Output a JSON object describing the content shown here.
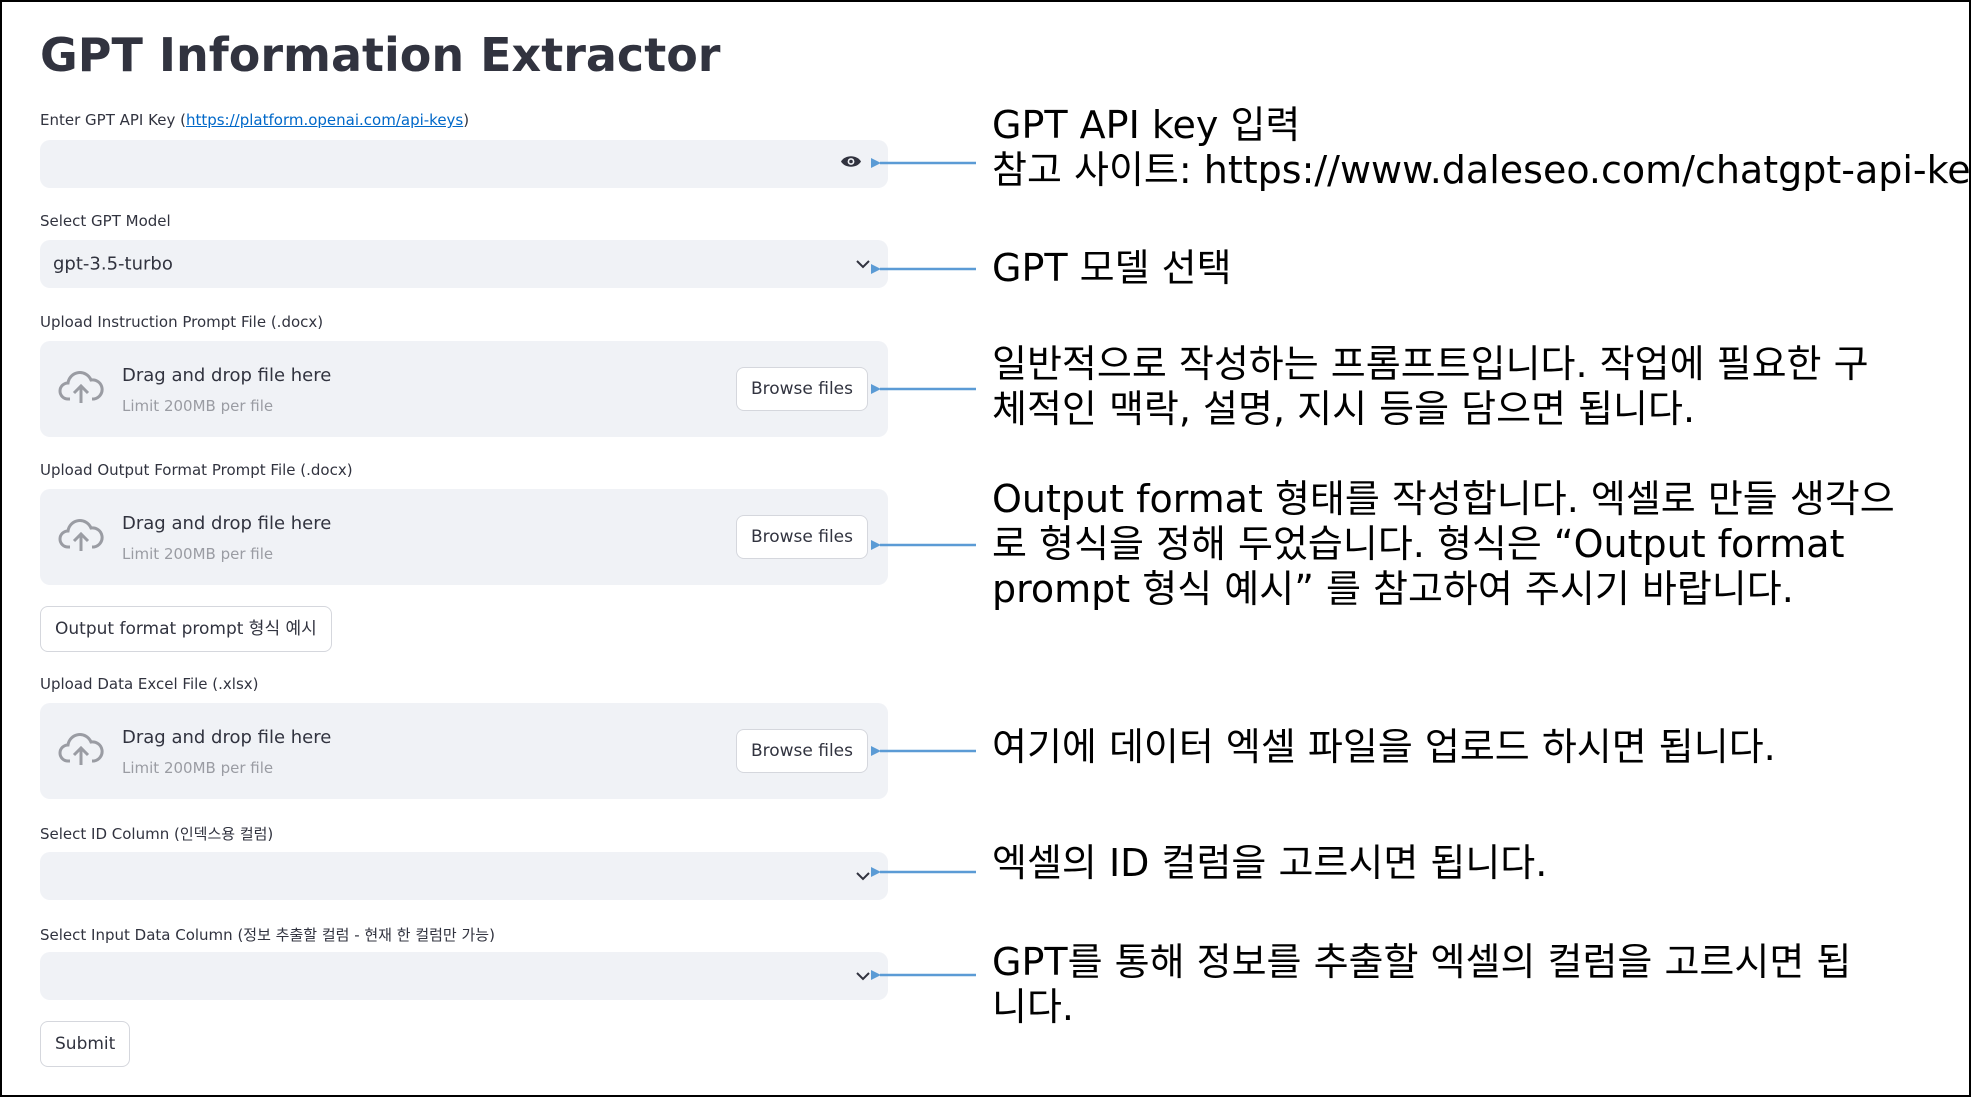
{
  "app": {
    "title": "GPT Information Extractor"
  },
  "fields": {
    "api_key": {
      "label_prefix": "Enter GPT API Key (",
      "link": "https://platform.openai.com/api-keys",
      "label_suffix": ")",
      "value": ""
    },
    "model": {
      "label": "Select GPT Model",
      "selected": "gpt-3.5-turbo"
    },
    "instruction_upload": {
      "label": "Upload Instruction Prompt File (.docx)",
      "drop_text": "Drag and drop file here",
      "limit_text": "Limit 200MB per file",
      "browse_label": "Browse files"
    },
    "output_upload": {
      "label": "Upload Output Format Prompt File (.docx)",
      "drop_text": "Drag and drop file here",
      "limit_text": "Limit 200MB per file",
      "browse_label": "Browse files"
    },
    "example_button": {
      "label": "Output format prompt 형식 예시"
    },
    "data_upload": {
      "label": "Upload Data Excel File (.xlsx)",
      "drop_text": "Drag and drop file here",
      "limit_text": "Limit 200MB per file",
      "browse_label": "Browse files"
    },
    "id_column": {
      "label": "Select ID Column (인덱스용 컬럼)",
      "selected": ""
    },
    "input_column": {
      "label": "Select Input Data Column (정보 추출할 컬럼 - 현재 한 컬럼만 가능)",
      "selected": ""
    },
    "submit": {
      "label": "Submit"
    }
  },
  "annotations": {
    "api_key": [
      "GPT API key 입력",
      "참고 사이트: https://www.daleseo.com/chatgpt-api-keys/"
    ],
    "model": [
      "GPT 모델 선택"
    ],
    "instruction": [
      "일반적으로 작성하는 프롬프트입니다. 작업에 필요한 구",
      "체적인 맥락, 설명, 지시 등을 담으면 됩니다."
    ],
    "output_format": [
      "Output format 형태를 작성합니다. 엑셀로 만들 생각으",
      "로 형식을 정해 두었습니다. 형식은 “Output format",
      "prompt 형식 예시” 를 참고하여 주시기 바랍니다."
    ],
    "data": [
      "여기에 데이터 엑셀 파일을 업로드 하시면 됩니다."
    ],
    "id_column": [
      "엑셀의 ID 컬럼을 고르시면 됩니다."
    ],
    "input_column": [
      "GPT를 통해 정보를 추출할 엑셀의 컬럼을 고르시면 됩",
      "니다."
    ]
  },
  "icons": {
    "eye": "eye-icon",
    "chevron": "chevron-down-icon",
    "cloud": "cloud-upload-icon",
    "arrow": "arrow-left-icon"
  },
  "colors": {
    "arrow": "#5b9bd5",
    "link": "#0068c9",
    "field_bg": "#f0f2f6"
  }
}
